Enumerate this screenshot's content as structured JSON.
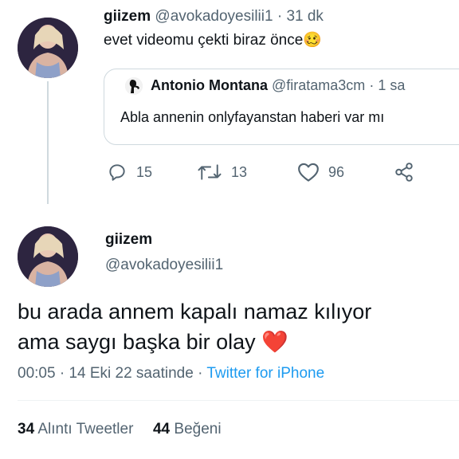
{
  "reply_tweet": {
    "display_name": "giizem",
    "handle": "@avokadoyesilii1",
    "dot": "·",
    "time": "31 dk",
    "text": "evet videomu çekti biraz önce",
    "emoji": "🥴",
    "quoted": {
      "display_name": "Antonio Montana",
      "handle": "@firatama3cm",
      "dot": "·",
      "time": "1 sa",
      "text": "Abla annenin onlyfayanstan haberi var mı"
    },
    "actions": {
      "replies": "15",
      "retweets": "13",
      "likes": "96"
    }
  },
  "main_tweet": {
    "display_name": "giizem",
    "handle": "@avokadoyesilii1",
    "text_line1": "bu arada annem kapalı namaz kılıyor",
    "text_line2": "ama saygı başka bir olay",
    "heart": "❤️",
    "time": "00:05",
    "sep1": "·",
    "date": "14 Eki 22 saatinde",
    "sep2": "·",
    "source": "Twitter for iPhone"
  },
  "stats": {
    "quote_count": "34",
    "quote_label": "Alıntı Tweetler",
    "like_count": "44",
    "like_label": "Beğeni"
  },
  "colors": {
    "link": "#1d9bf0",
    "muted": "#536471",
    "heart": "#e0245e"
  }
}
